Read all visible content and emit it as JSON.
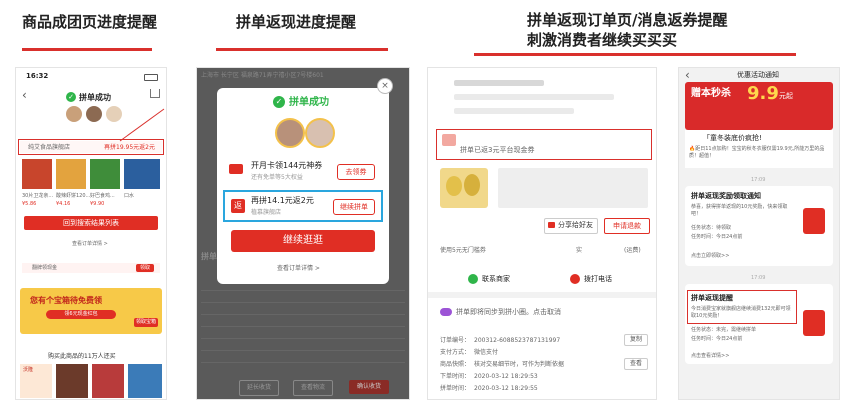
{
  "captions": {
    "c1": "商品成团页进度提醒",
    "c2": "拼单返现进度提醒",
    "c3_line1": "拼单返现订单页/消息返券提醒",
    "c3_line2": "刺激消费者继续买买买"
  },
  "phone1": {
    "time": "16:32",
    "status": "拼单成功",
    "shop": "纯艾食品旗舰店",
    "progress": "再拼19.95元返2元",
    "products": [
      "30片卫龙亲...",
      "酸辣虾饼120...",
      "好巴食鸡...",
      "口水"
    ],
    "prices": [
      "¥5.86",
      "¥4.16",
      "¥9.90",
      ""
    ],
    "back_button": "回到搜索结果列表",
    "order_link": "查看订单详情 >",
    "coupon_label": "翻牌领现金",
    "coupon_button": "领取",
    "banner_title": "您有个宝箱待免费领",
    "banner_sub": "领6元现金红包",
    "banner_btn": "领取宝箱",
    "footer": "购买此商品的11万人还买",
    "brand": "沃隆"
  },
  "phone2": {
    "addr": "上海市 长宁区 福泉路71弄宁禧小区7号楼601",
    "status": "拼单成功",
    "card1_title": "开月卡领144元神券",
    "card1_sub": "还有免单等5大权益",
    "card1_btn": "去领券",
    "rebate_icon": "返",
    "card2_title": "再拼14.1元返2元",
    "card2_sub": "植慕旗舰店",
    "card2_btn": "继续拼单",
    "main_btn": "继续逛逛",
    "order_link": "查看订单详情 >",
    "bg_title": "拼单",
    "bottom_btns": [
      "延长收货",
      "查看物流",
      "确认收货"
    ]
  },
  "phone3": {
    "rebate_text": "拼单已返3元平台现金券",
    "share_btn": "分享给好友",
    "refund_btn": "申请退款",
    "coupon_row": "使用5元无门槛券",
    "freight": "实",
    "freight_note": "(运费)",
    "contact": "联系商家",
    "call": "拨打电话",
    "sync": "拼单即将同步到拼小圈。点击取消",
    "labels": [
      "订单编号：",
      "支付方式：",
      "商品快照：",
      "下单时间：",
      "拼单时间："
    ],
    "values": [
      "200312-6088523787131997",
      "微信支付",
      "核对交易细节时，可作为判断依据",
      "2020-03-12 18:29:53",
      "2020-03-12 18:29:55"
    ],
    "copy_btn": "复制",
    "view_btn": "查看"
  },
  "phone4": {
    "title": "优惠活动通知",
    "banner_big": "赠本秒杀",
    "banner_num": "9.9",
    "banner_sub": "元起",
    "promo_text": "「童冬装底价疯抢!",
    "promo_sub": "🔥距日11点加购！宝宝的秋冬衣服仅需19.9元,所能万里的品质！超值！",
    "time1": "17:09",
    "card1_title": "拼单返现奖励领取通知",
    "card1_body": "恭喜，获得拼单返现的10元奖励，快来领取吧！",
    "card1_status": "任务状态：待领取",
    "card1_reward": "任务时间：今日24点前",
    "card1_link": "点击立即领取>>",
    "time2": "17:09",
    "card2_title": "拼单返现提醒",
    "card2_body": "今日消费宝家就旗舰店继续消费132元即可领取10元奖励！",
    "card2_status": "任务状态：未完，需继续拼单",
    "card2_reward": "任务时间：今日24点前",
    "card2_link": "点击查看详情>>"
  },
  "colors": {
    "accent": "#d9302c",
    "pdd_red": "#e02e24",
    "highlight_blue": "#2aa6de",
    "success_green": "#2fb54a"
  }
}
